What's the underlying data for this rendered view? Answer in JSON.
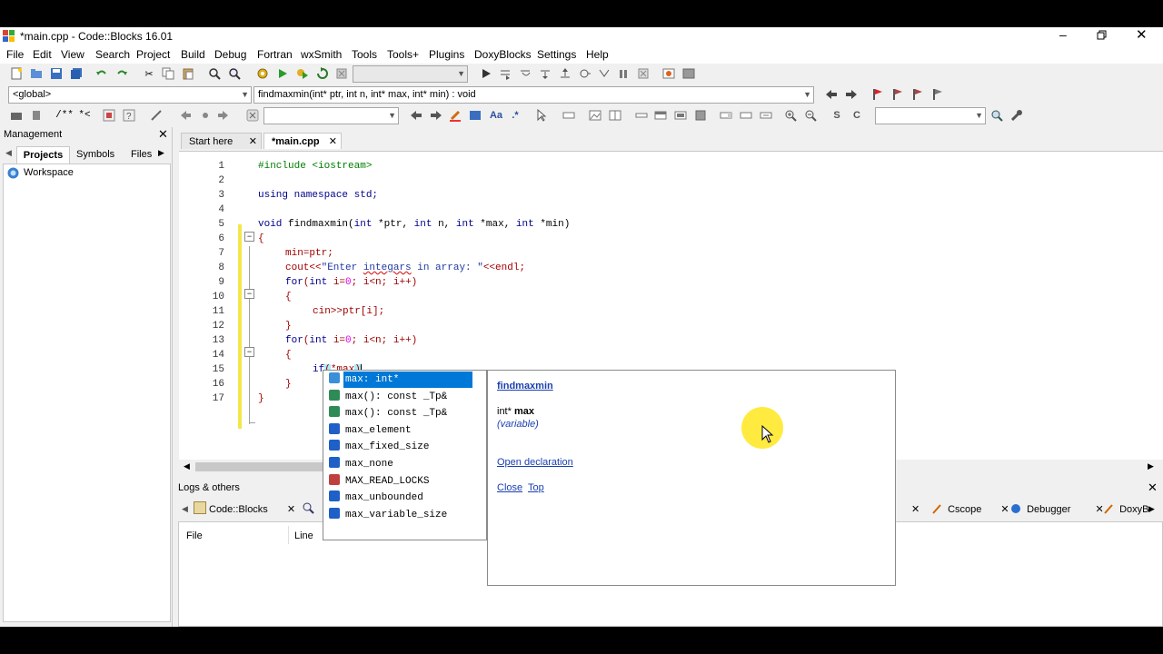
{
  "window": {
    "title": "*main.cpp - Code::Blocks 16.01"
  },
  "menu": [
    "File",
    "Edit",
    "View",
    "Search",
    "Project",
    "Build",
    "Debug",
    "Fortran",
    "wxSmith",
    "Tools",
    "Tools+",
    "Plugins",
    "DoxyBlocks",
    "Settings",
    "Help"
  ],
  "scope_combo": {
    "value": "<global>"
  },
  "function_combo": {
    "value": "findmaxmin(int* ptr, int n, int* max, int* min) : void"
  },
  "management": {
    "title": "Management",
    "tabs": [
      "Projects",
      "Symbols",
      "Files"
    ],
    "workspace": "Workspace"
  },
  "editor_tabs": [
    "Start here",
    "*main.cpp"
  ],
  "code_lines": [
    {
      "n": "1"
    },
    {
      "n": "2"
    },
    {
      "n": "3"
    },
    {
      "n": "4"
    },
    {
      "n": "5"
    },
    {
      "n": "6"
    },
    {
      "n": "7"
    },
    {
      "n": "8"
    },
    {
      "n": "9"
    },
    {
      "n": "10"
    },
    {
      "n": "11"
    },
    {
      "n": "12"
    },
    {
      "n": "13"
    },
    {
      "n": "14"
    },
    {
      "n": "15"
    },
    {
      "n": "16"
    },
    {
      "n": "17"
    }
  ],
  "code": {
    "l1_a": "#include ",
    "l1_b": "<iostream>",
    "l3": "using namespace std;",
    "l5_a": "void",
    "l5_b": " findmaxmin(",
    "l5_c": "int",
    "l5_d": " *ptr, ",
    "l5_e": "int",
    "l5_f": " n, ",
    "l5_g": "int",
    "l5_h": " *max, ",
    "l5_i": "int",
    "l5_j": " *min)",
    "l6": "{",
    "l7": "min=ptr;",
    "l8_a": "cout<<",
    "l8_b": "\"Enter ",
    "l8_c": "integars",
    "l8_d": " in array: \"",
    "l8_e": "<<endl;",
    "l9_a": "for",
    "l9_b": "(",
    "l9_c": "int",
    "l9_d": " i=",
    "l9_e": "0",
    "l9_f": "; i<n; i++)",
    "l10": "{",
    "l11": "cin>>ptr[i];",
    "l12": "}",
    "l13_a": "for",
    "l13_b": "(",
    "l13_c": "int",
    "l13_d": " i=",
    "l13_e": "0",
    "l13_f": "; i<n; i++)",
    "l14": "{",
    "l15_a": "if",
    "l15_b": "(",
    "l15_c": "*max",
    "l15_d": ")",
    "l16": "}",
    "l17": "}"
  },
  "autocomplete": [
    {
      "label": "max: int*",
      "icon": "variable-icon",
      "color": "#3a8fd8"
    },
    {
      "label": "max(): const _Tp&",
      "icon": "function-icon",
      "color": "#2e8b57"
    },
    {
      "label": "max(): const _Tp&",
      "icon": "function-icon",
      "color": "#2e8b57"
    },
    {
      "label": "max_element",
      "icon": "template-icon",
      "color": "#1e5fc8"
    },
    {
      "label": "max_fixed_size",
      "icon": "template-icon",
      "color": "#1e5fc8"
    },
    {
      "label": "max_none",
      "icon": "template-icon",
      "color": "#1e5fc8"
    },
    {
      "label": "MAX_READ_LOCKS",
      "icon": "macro-icon",
      "color": "#c04040"
    },
    {
      "label": "max_unbounded",
      "icon": "template-icon",
      "color": "#1e5fc8"
    },
    {
      "label": "max_variable_size",
      "icon": "template-icon",
      "color": "#1e5fc8"
    }
  ],
  "doc_popup": {
    "title": "findmaxmin",
    "type": "int*",
    "name": "max",
    "kind": "(variable)",
    "open_link": "Open declaration",
    "close_link": "Close",
    "top_link": "Top"
  },
  "logs": {
    "title": "Logs & others",
    "tabs_left": [
      "Code::Blocks"
    ],
    "tabs_right": [
      "Cscope",
      "Debugger",
      "DoxyB"
    ],
    "columns": [
      "File",
      "Line"
    ]
  }
}
